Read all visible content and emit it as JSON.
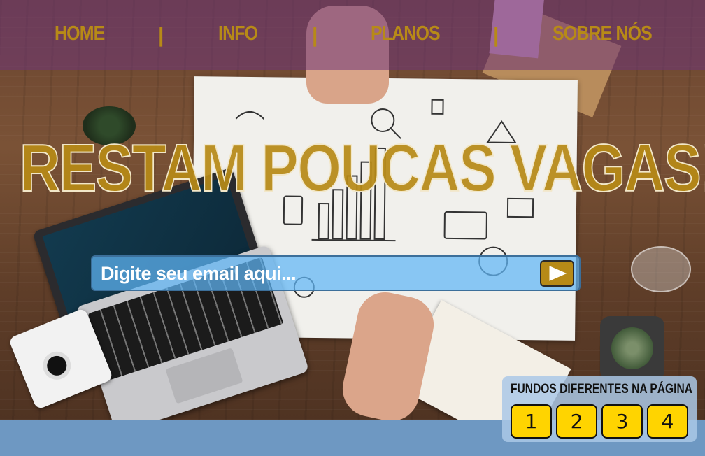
{
  "nav": {
    "items": [
      {
        "label": "HOME"
      },
      {
        "label": "INFO"
      },
      {
        "label": "PLANOS"
      },
      {
        "label": "SOBRE NÓS"
      }
    ],
    "separator": "|"
  },
  "hero": {
    "headline": "RESTAM POUCAS VAGAS!"
  },
  "subscribe": {
    "placeholder": "Digite seu email aqui...",
    "send_icon": "play-arrow-icon"
  },
  "backgrounds": {
    "title": "FUNDOS DIFERENTES NA PÁGINA",
    "buttons": [
      "1",
      "2",
      "3",
      "4"
    ]
  },
  "colors": {
    "accent_gold": "#b78a17",
    "nav_overlay": "#6e3478",
    "email_bar": "#60b5f5",
    "button_yellow": "#ffd400",
    "bottom_band": "#6e98c2"
  }
}
